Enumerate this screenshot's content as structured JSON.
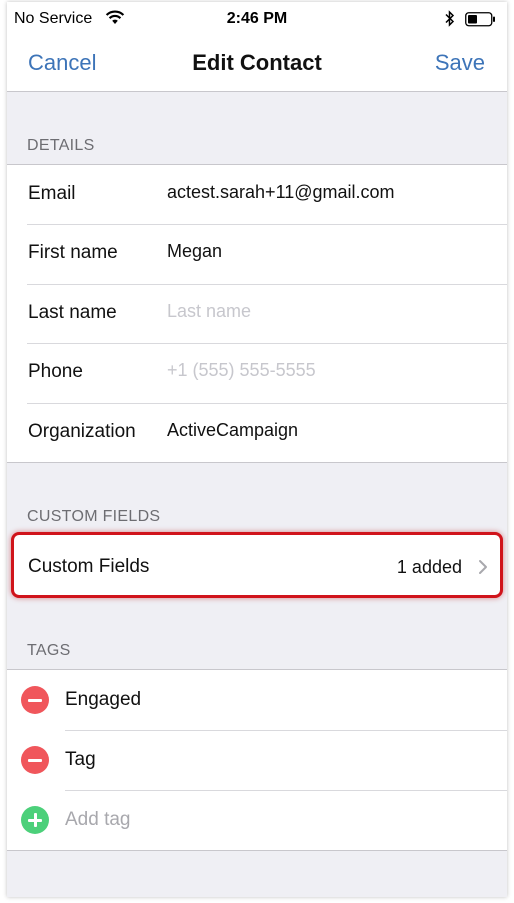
{
  "status_bar": {
    "carrier": "No Service",
    "time": "2:46 PM",
    "icons": [
      "wifi-icon",
      "bluetooth-icon",
      "battery-icon"
    ]
  },
  "nav": {
    "cancel_label": "Cancel",
    "title": "Edit Contact",
    "save_label": "Save",
    "accent_color": "#3d74b8"
  },
  "details": {
    "header": "DETAILS",
    "rows": [
      {
        "label": "Email",
        "value": "actest.sarah+11@gmail.com",
        "placeholder": ""
      },
      {
        "label": "First name",
        "value": "Megan",
        "placeholder": ""
      },
      {
        "label": "Last name",
        "value": "",
        "placeholder": "Last name"
      },
      {
        "label": "Phone",
        "value": "",
        "placeholder": "+1 (555) 555-5555"
      },
      {
        "label": "Organization",
        "value": "ActiveCampaign",
        "placeholder": ""
      }
    ]
  },
  "custom_fields": {
    "header": "CUSTOM FIELDS",
    "label": "Custom Fields",
    "count": "1 added",
    "highlight_color": "#d0141b"
  },
  "tags": {
    "header": "TAGS",
    "items": [
      {
        "label": "Engaged"
      },
      {
        "label": "Tag"
      }
    ],
    "add_placeholder": "Add tag",
    "remove_color": "#f0565b",
    "add_color": "#4cd07a"
  }
}
